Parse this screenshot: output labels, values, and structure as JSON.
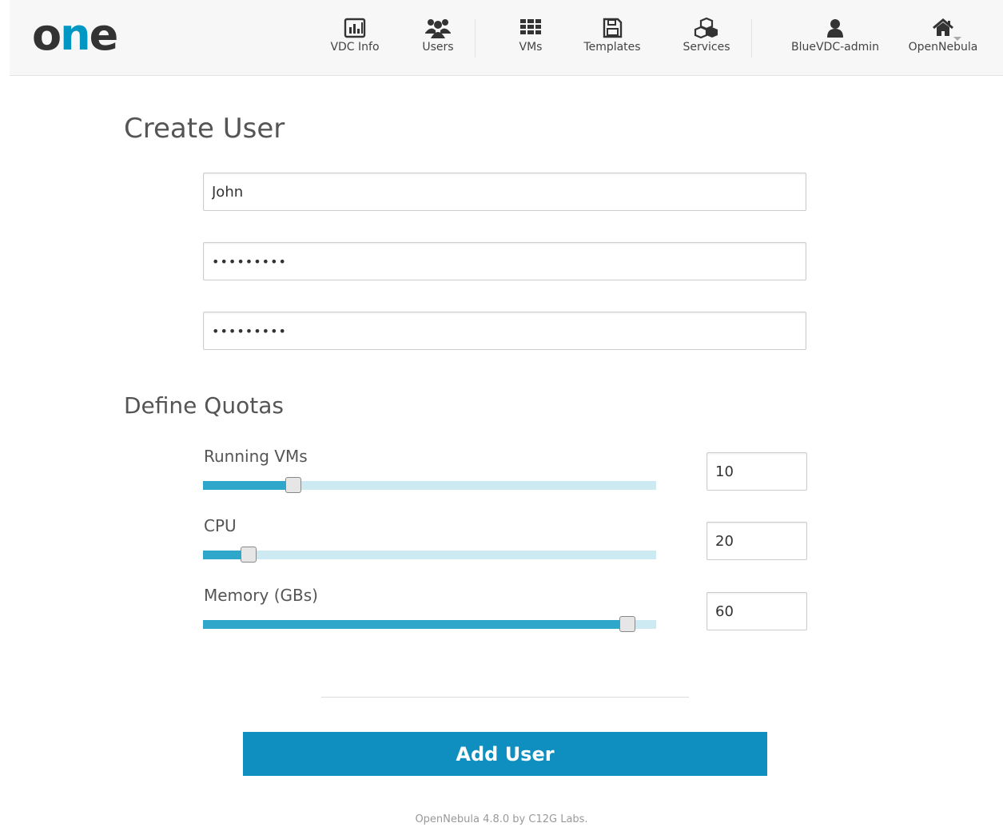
{
  "header": {
    "logo": {
      "o": "o",
      "n": "n",
      "e": "e"
    },
    "nav": [
      {
        "label": "VDC Info",
        "icon": "bar-chart-icon"
      },
      {
        "label": "Users",
        "icon": "users-icon"
      },
      {
        "label": "VMs",
        "icon": "grid-icon"
      },
      {
        "label": "Templates",
        "icon": "floppy-disk-icon"
      },
      {
        "label": "Services",
        "icon": "cubes-icon"
      },
      {
        "label": "BlueVDC-admin",
        "icon": "user-icon"
      },
      {
        "label": "OpenNebula",
        "icon": "home-icon"
      }
    ]
  },
  "form": {
    "title": "Create User",
    "username": "John",
    "password": "•••••••••",
    "confirm_password": "•••••••••"
  },
  "quotas": {
    "title": "Define Quotas",
    "items": [
      {
        "label": "Running VMs",
        "value": "10",
        "fraction": 0.2
      },
      {
        "label": "CPU",
        "value": "20",
        "fraction": 0.1
      },
      {
        "label": "Memory (GBs)",
        "value": "60",
        "fraction": 0.937
      }
    ]
  },
  "submit_label": "Add User",
  "footer": "OpenNebula 4.8.0 by C12G Labs.",
  "colors": {
    "accent": "#0e8fbf",
    "slider_fill": "#2fa7cb",
    "slider_track": "#cdeaf3"
  }
}
